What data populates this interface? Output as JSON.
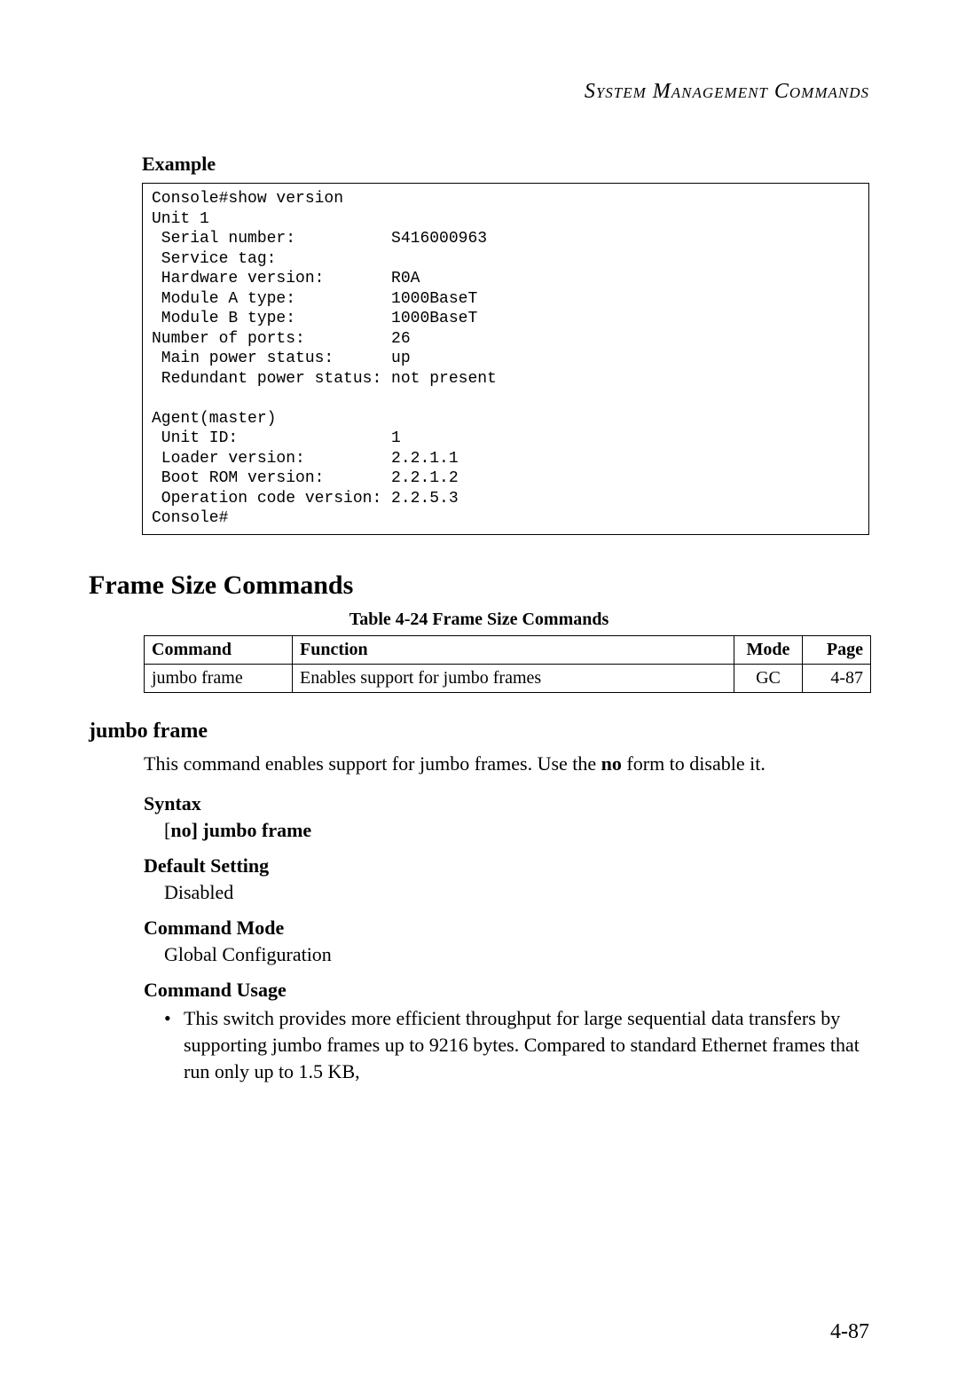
{
  "running_head": "System Management Commands",
  "example_label": "Example",
  "code_block": "Console#show version\nUnit 1\n Serial number:          S416000963\n Service tag:\n Hardware version:       R0A\n Module A type:          1000BaseT\n Module B type:          1000BaseT\nNumber of ports:         26\n Main power status:      up\n Redundant power status: not present\n\nAgent(master)\n Unit ID:                1\n Loader version:         2.2.1.1\n Boot ROM version:       2.2.1.2\n Operation code version: 2.2.5.3\nConsole#",
  "section_heading": "Frame Size Commands",
  "table": {
    "caption": "Table 4-24  Frame Size Commands",
    "headers": {
      "command": "Command",
      "function": "Function",
      "mode": "Mode",
      "page": "Page"
    },
    "rows": [
      {
        "command": "jumbo frame",
        "function": "Enables support for jumbo frames",
        "mode": "GC",
        "page": "4-87"
      }
    ]
  },
  "subsection_heading": "jumbo frame",
  "desc_prefix": "This command enables support for jumbo frames. Use the ",
  "desc_bold": "no",
  "desc_suffix": " form to disable it.",
  "syntax_label": "Syntax",
  "syntax_line_prefix": "[",
  "syntax_line_bold": "no] jumbo frame",
  "default_label": "Default Setting",
  "default_value": "Disabled",
  "mode_label": "Command Mode",
  "mode_value": "Global Configuration",
  "usage_label": "Command Usage",
  "usage_item": "This switch provides more efficient throughput for large sequential data transfers by supporting jumbo frames up to 9216 bytes. Compared to standard Ethernet frames that run only up to 1.5 KB,",
  "page_number": "4-87"
}
